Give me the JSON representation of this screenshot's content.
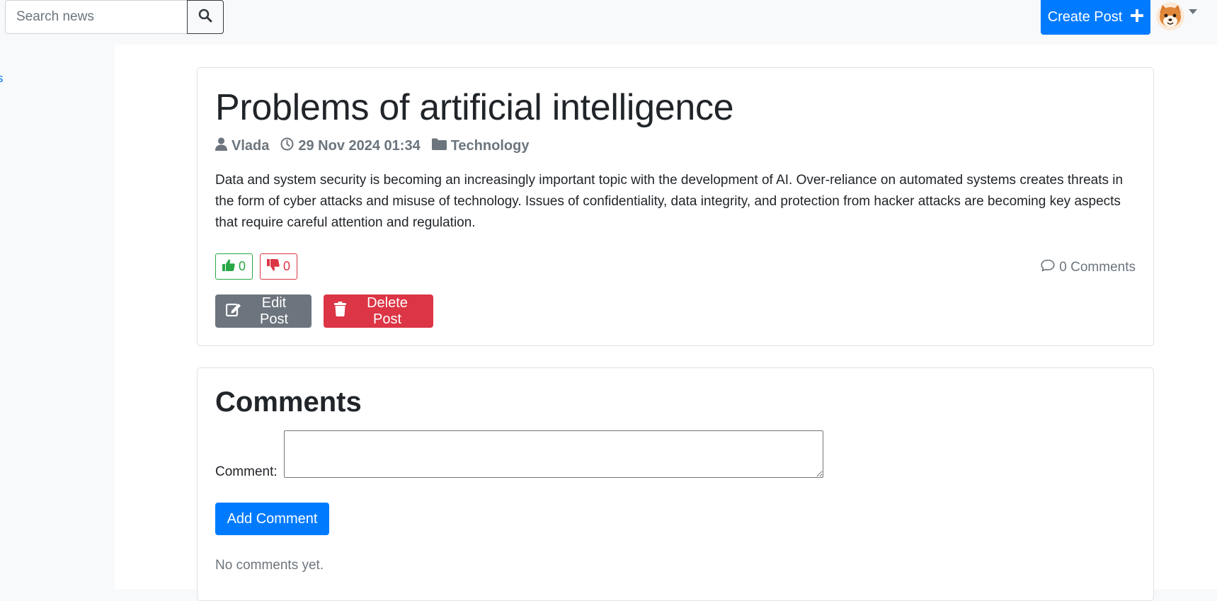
{
  "header": {
    "search_placeholder": "Search news",
    "search_icon": "search-icon",
    "create_post_label": "Create Post",
    "create_icon": "plus-icon",
    "avatar_icon": "shiba-avatar",
    "accent_color": "#007bff"
  },
  "sidebar": {
    "partial_link": "s"
  },
  "post": {
    "title": "Problems of artificial intelligence",
    "author": "Vlada",
    "date": "29 Nov 2024 01:34",
    "category": "Technology",
    "body": "Data and system security is becoming an increasingly important topic with the development of AI. Over-reliance on automated systems creates threats in the form of cyber attacks and misuse of technology. Issues of confidentiality, data integrity, and protection from hacker attacks are becoming key aspects that require careful attention and regulation.",
    "likes": "0",
    "dislikes": "0",
    "comments_count": "0 Comments",
    "edit_label": "Edit Post",
    "delete_label": "Delete Post"
  },
  "comments": {
    "title": "Comments",
    "field_label": "Comment:",
    "field_value": "",
    "add_label": "Add Comment",
    "empty_text": "No comments yet."
  },
  "colors": {
    "success": "#28a745",
    "danger": "#dc3545",
    "secondary": "#6c757d",
    "primary": "#007bff"
  }
}
